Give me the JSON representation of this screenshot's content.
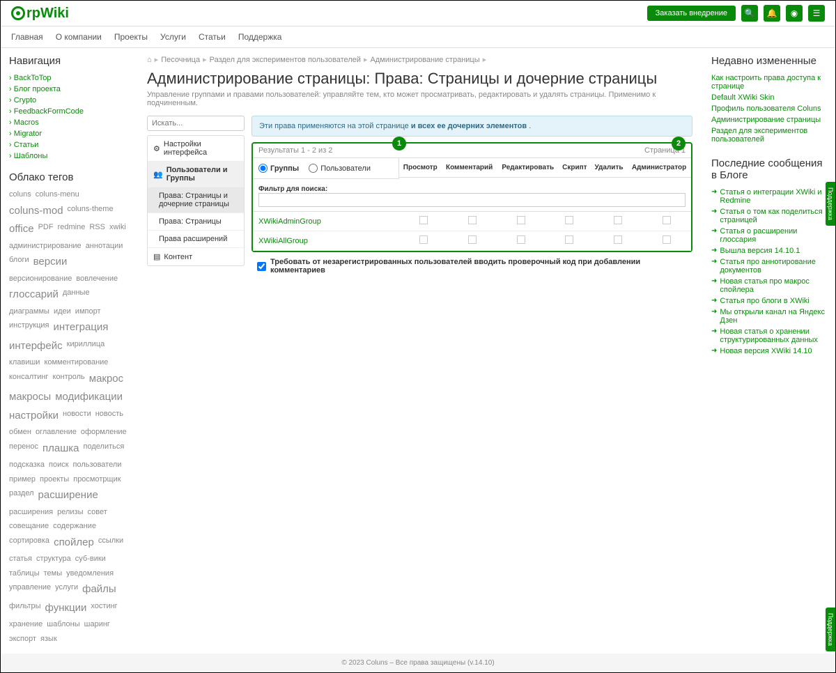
{
  "header": {
    "logo_text": "rpWiki",
    "order_btn": "Заказать внедрение"
  },
  "nav": [
    "Главная",
    "О компании",
    "Проекты",
    "Услуги",
    "Статьи",
    "Поддержка"
  ],
  "left": {
    "nav_title": "Навигация",
    "nav_items": [
      "BackToTop",
      "Блог проекта",
      "Crypto",
      "FeedbackFormCode",
      "Macros",
      "Migrator",
      "Статьи",
      "Шаблоны"
    ],
    "tags_title": "Облако тегов",
    "tags": [
      {
        "t": "coluns",
        "s": 1
      },
      {
        "t": "coluns-menu",
        "s": 1
      },
      {
        "t": "coluns-mod",
        "s": 3
      },
      {
        "t": "coluns-theme",
        "s": 1
      },
      {
        "t": "office",
        "s": 3
      },
      {
        "t": "PDF",
        "s": 1
      },
      {
        "t": "redmine",
        "s": 1
      },
      {
        "t": "RSS",
        "s": 1
      },
      {
        "t": "xwiki",
        "s": 1
      },
      {
        "t": "администрирование",
        "s": 1
      },
      {
        "t": "аннотации",
        "s": 1
      },
      {
        "t": "блоги",
        "s": 1
      },
      {
        "t": "версии",
        "s": 3
      },
      {
        "t": "версионирование",
        "s": 1
      },
      {
        "t": "вовлечение",
        "s": 1
      },
      {
        "t": "глоссарий",
        "s": 3
      },
      {
        "t": "данные",
        "s": 1
      },
      {
        "t": "диаграммы",
        "s": 1
      },
      {
        "t": "идеи",
        "s": 1
      },
      {
        "t": "импорт",
        "s": 1
      },
      {
        "t": "инструкция",
        "s": 1
      },
      {
        "t": "интеграция",
        "s": 3
      },
      {
        "t": "интерфейс",
        "s": 3
      },
      {
        "t": "кириллица",
        "s": 1
      },
      {
        "t": "клавиши",
        "s": 1
      },
      {
        "t": "комментирование",
        "s": 1
      },
      {
        "t": "консалтинг",
        "s": 1
      },
      {
        "t": "контроль",
        "s": 1
      },
      {
        "t": "макрос",
        "s": 3
      },
      {
        "t": "макросы",
        "s": 3
      },
      {
        "t": "модификации",
        "s": 3
      },
      {
        "t": "настройки",
        "s": 3
      },
      {
        "t": "новости",
        "s": 1
      },
      {
        "t": "новость",
        "s": 1
      },
      {
        "t": "обмен",
        "s": 1
      },
      {
        "t": "оглавление",
        "s": 1
      },
      {
        "t": "оформление",
        "s": 1
      },
      {
        "t": "перенос",
        "s": 1
      },
      {
        "t": "плашка",
        "s": 3
      },
      {
        "t": "поделиться",
        "s": 1
      },
      {
        "t": "подсказка",
        "s": 1
      },
      {
        "t": "поиск",
        "s": 1
      },
      {
        "t": "пользователи",
        "s": 1
      },
      {
        "t": "пример",
        "s": 1
      },
      {
        "t": "проекты",
        "s": 1
      },
      {
        "t": "просмотрщик",
        "s": 1
      },
      {
        "t": "раздел",
        "s": 1
      },
      {
        "t": "расширение",
        "s": 3
      },
      {
        "t": "расширения",
        "s": 1
      },
      {
        "t": "релизы",
        "s": 1
      },
      {
        "t": "совет",
        "s": 1
      },
      {
        "t": "совещание",
        "s": 1
      },
      {
        "t": "содержание",
        "s": 1
      },
      {
        "t": "сортировка",
        "s": 1
      },
      {
        "t": "спойлер",
        "s": 3
      },
      {
        "t": "ссылки",
        "s": 1
      },
      {
        "t": "статья",
        "s": 1
      },
      {
        "t": "структура",
        "s": 1
      },
      {
        "t": "суб-вики",
        "s": 1
      },
      {
        "t": "таблицы",
        "s": 1
      },
      {
        "t": "темы",
        "s": 1
      },
      {
        "t": "уведомления",
        "s": 1
      },
      {
        "t": "управление",
        "s": 1
      },
      {
        "t": "услуги",
        "s": 1
      },
      {
        "t": "файлы",
        "s": 3
      },
      {
        "t": "фильтры",
        "s": 1
      },
      {
        "t": "функции",
        "s": 3
      },
      {
        "t": "хостинг",
        "s": 1
      },
      {
        "t": "хранение",
        "s": 1
      },
      {
        "t": "шаблоны",
        "s": 1
      },
      {
        "t": "шаринг",
        "s": 1
      },
      {
        "t": "экспорт",
        "s": 1
      },
      {
        "t": "язык",
        "s": 1
      }
    ]
  },
  "breadcrumb": [
    "Песочница",
    "Раздел для экспериментов пользователей",
    "Администрирование страницы"
  ],
  "page": {
    "title": "Администрирование страницы: Права: Страницы и дочерние страницы",
    "subtitle": "Управление группами и правами пользователей: управляйте тем, кто может просматривать, редактировать и удалять страницы. Применимо к подчиненным."
  },
  "admin_menu": {
    "search_ph": "Искать...",
    "items": [
      {
        "label": "Настройки интерфейса",
        "icon": "⚙"
      },
      {
        "label": "Пользователи и Группы",
        "icon": "👥",
        "active": true
      },
      {
        "label": "Права: Страницы и дочерние страницы",
        "sub": true,
        "sel": true
      },
      {
        "label": "Права: Страницы",
        "sub": true
      },
      {
        "label": "Права расширений",
        "sub": true
      },
      {
        "label": "Контент",
        "icon": "▤"
      }
    ]
  },
  "info": {
    "text": "Эти права применяются на этой странице",
    "link1": "и всех",
    "link2": "ее дочерних элементов"
  },
  "rights": {
    "results": "Результаты 1 - 2 из 2",
    "page_label": "Страница 1",
    "radio_groups": "Группы",
    "radio_users": "Пользователи",
    "filter_label": "Фильтр для поиска:",
    "cols": [
      "Просмотр",
      "Комментарий",
      "Редактировать",
      "Скрипт",
      "Удалить",
      "Администратор"
    ],
    "rows": [
      "XWikiAdminGroup",
      "XWikiAllGroup"
    ],
    "badge1": "1",
    "badge2": "2",
    "note": "Требовать от незарегистрированных пользователей вводить проверочный код при добавлении комментариев"
  },
  "right": {
    "recent_title": "Недавно измененные",
    "recent": [
      "Как настроить права доступа к странице",
      "Default XWiki Skin",
      "Профиль пользователя Coluns",
      "Администрирование страницы",
      "Раздел для экспериментов пользователей"
    ],
    "blog_title": "Последние сообщения в Блоге",
    "blog": [
      "Статья о интеграции XWiki и Redmine",
      "Статья о том как поделиться страницей",
      "Статья о расширении глоссария",
      "Вышла версия 14.10.1",
      "Статья про аннотирование документов",
      "Новая статья про макрос спойлера",
      "Статья про блоги в XWiki",
      "Мы открыли канал на Яндекс Дзен",
      "Новая статья о хранении структурированных данных",
      "Новая версия XWiki 14.10"
    ]
  },
  "footer": "© 2023 Coluns – Все права защищены (v.14.10)",
  "support": "Поддержка"
}
